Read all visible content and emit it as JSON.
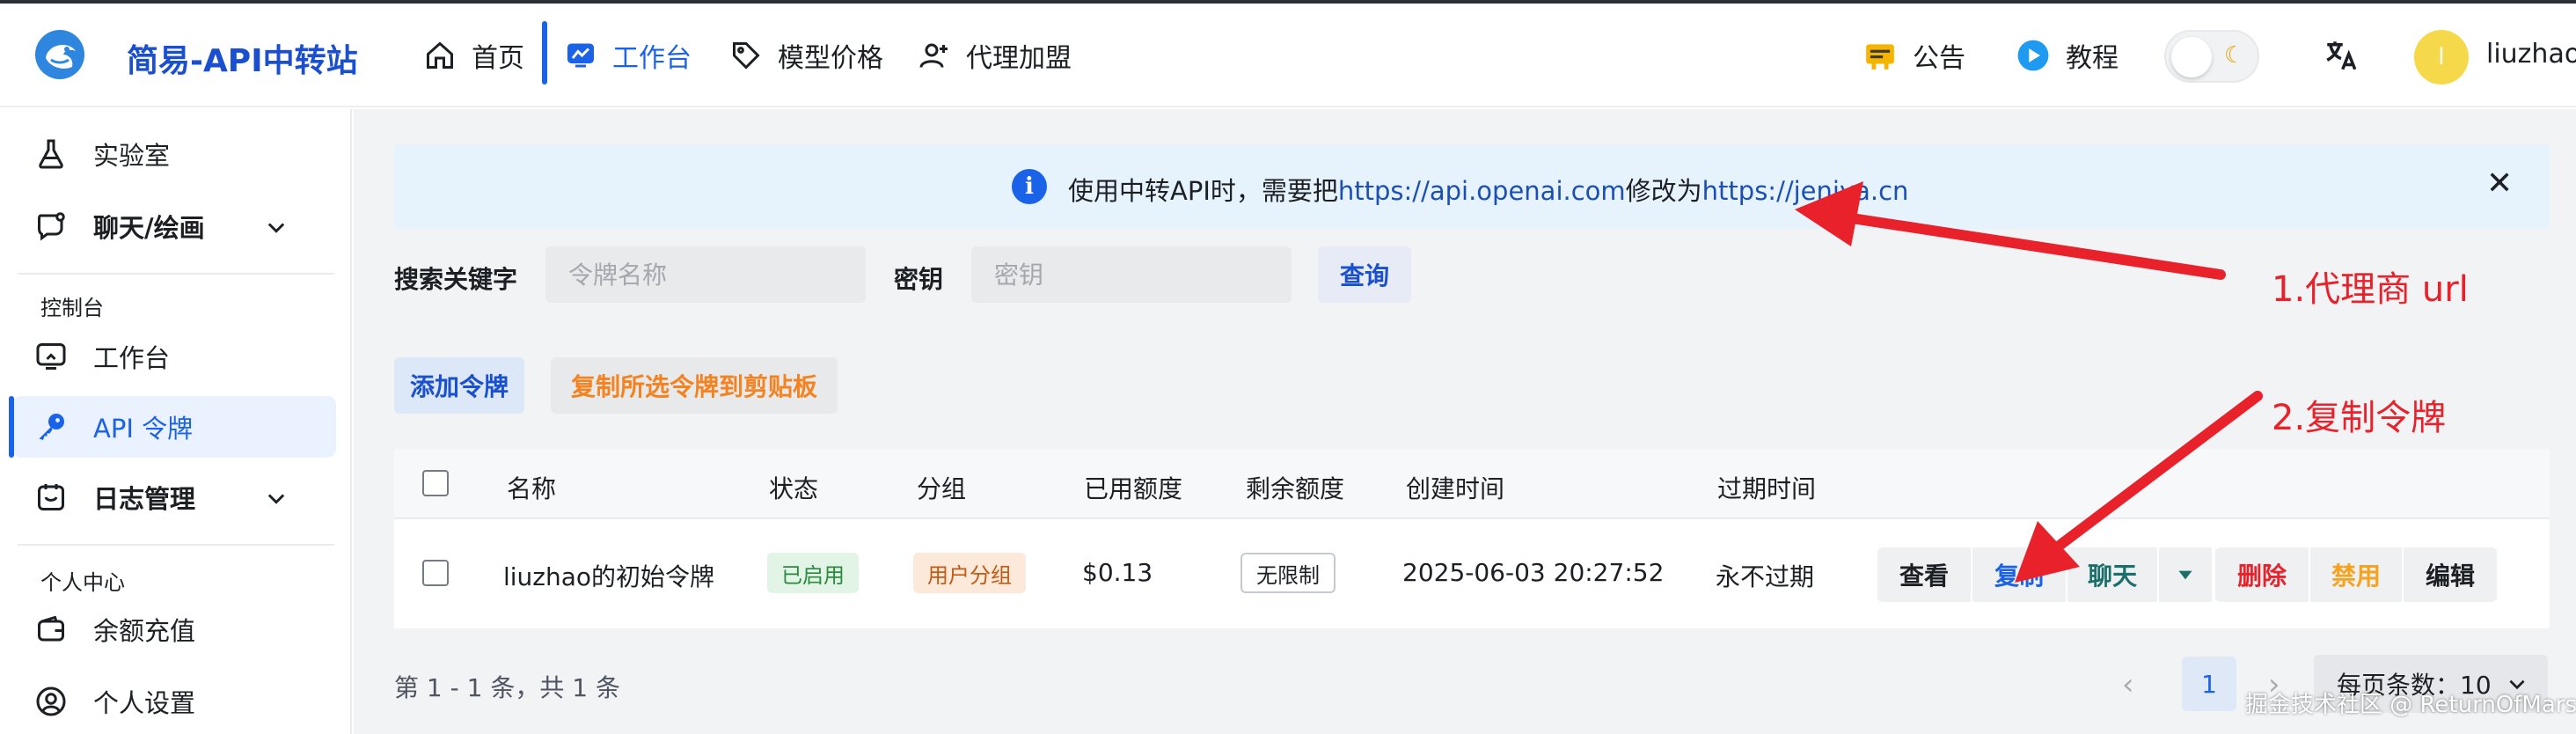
{
  "header": {
    "brand": "简易-API中转站",
    "nav": [
      {
        "label": "首页",
        "icon": "home-icon"
      },
      {
        "label": "工作台",
        "icon": "monitor-icon",
        "active": true
      },
      {
        "label": "模型价格",
        "icon": "price-tag-icon"
      },
      {
        "label": "代理加盟",
        "icon": "user-add-icon"
      }
    ],
    "announcement": "公告",
    "tutorial": "教程",
    "avatar_letter": "l",
    "username": "liuzhao"
  },
  "sidebar": {
    "items": [
      {
        "label": "实验室",
        "icon": "flask-icon"
      },
      {
        "label": "聊天/绘画",
        "icon": "chat-icon"
      },
      {
        "label": "工作台",
        "icon": "monitor-icon"
      },
      {
        "label": "API 令牌",
        "icon": "key-icon",
        "active": true
      },
      {
        "label": "日志管理",
        "icon": "calendar-icon"
      },
      {
        "label": "余额充值",
        "icon": "wallet-icon"
      },
      {
        "label": "个人设置",
        "icon": "user-circle-icon"
      }
    ],
    "sections": [
      "控制台",
      "个人中心"
    ]
  },
  "banner": {
    "prefix": "使用中转API时，需要把",
    "from_url": "https://api.openai.com",
    "middle": "修改为",
    "to_url": "https://jeniya.cn"
  },
  "search": {
    "keyword_label": "搜索关键字",
    "keyword_placeholder": "令牌名称",
    "key_label": "密钥",
    "key_placeholder": "密钥",
    "query_button": "查询"
  },
  "toolbar": {
    "add_button": "添加令牌",
    "copy_selected_button": "复制所选令牌到剪贴板"
  },
  "table": {
    "columns": [
      "名称",
      "状态",
      "分组",
      "已用额度",
      "剩余额度",
      "创建时间",
      "过期时间"
    ],
    "rows": [
      {
        "name": "liuzhao的初始令牌",
        "status": "已启用",
        "group": "用户分组",
        "used": "$0.13",
        "remaining": "无限制",
        "created": "2025-06-03 20:27:52",
        "expires": "永不过期",
        "actions": [
          "查看",
          "复制",
          "聊天",
          "删除",
          "禁用",
          "编辑"
        ]
      }
    ]
  },
  "pagination": {
    "info": "第 1 - 1 条，共 1 条",
    "current_page": "1",
    "page_size_label": "每页条数：10"
  },
  "annotations": {
    "note1": "1.代理商 url",
    "note2": "2.复制令牌"
  },
  "watermark": "掘金技术社区 @ ReturnOfMars",
  "colors": {
    "primary": "#1a62e8",
    "brand": "#1a4fcf",
    "danger": "#e8212a",
    "warning": "#f5821f",
    "success": "#2a8a3d",
    "annotation": "#e8212a"
  }
}
